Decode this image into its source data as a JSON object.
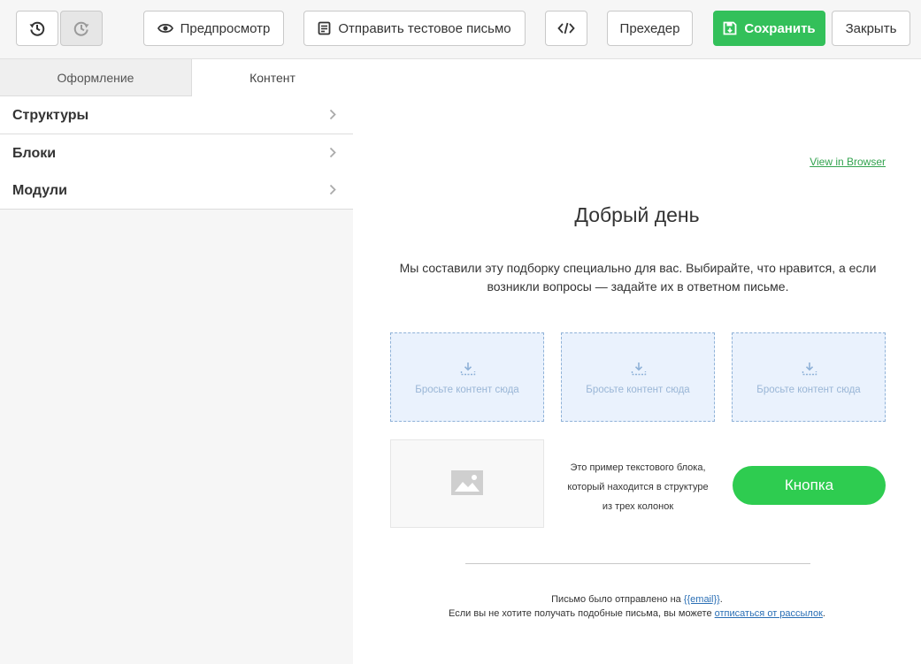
{
  "toolbar": {
    "history_back_icon": "history-icon",
    "history_forward_icon": "history-forward-icon",
    "preview_label": "Предпросмотр",
    "preview_icon": "eye-icon",
    "test_email_label": "Отправить тестовое письмо",
    "test_email_icon": "document-icon",
    "code_icon": "code-icon",
    "preheader_label": "Прехедер",
    "save_label": "Сохранить",
    "save_icon": "save-icon",
    "close_label": "Закрыть"
  },
  "panel": {
    "tabs": [
      {
        "label": "Оформление",
        "active": false
      },
      {
        "label": "Контент",
        "active": true
      }
    ],
    "sections": [
      {
        "label": "Структуры"
      },
      {
        "label": "Блоки"
      },
      {
        "label": "Модули"
      }
    ]
  },
  "email": {
    "view_in_browser": "View in Browser",
    "greeting": "Добрый день",
    "intro_line1": "Мы составили эту подборку специально для вас. Выбирайте, что нравится, а если",
    "intro_line2": "возникли вопросы — задайте их в ответном письме.",
    "drop_zones": [
      {
        "label": "Бросьте контент сюда"
      },
      {
        "label": "Бросьте контент сюда"
      },
      {
        "label": "Бросьте контент сюда"
      }
    ],
    "image_placeholder_icon": "image-icon",
    "sample_text_line1": "Это пример текстового блока,",
    "sample_text_line2": "который находится в структуре",
    "sample_text_line3": "из трех колонок",
    "button_label": "Кнопка",
    "footer": {
      "sent_prefix": "Письмо было отправлено на ",
      "email_var": "{{email}}",
      "sent_suffix": ".",
      "unsub_prefix": "Если вы не хотите получать подобные письма, вы можете ",
      "unsub_link": "отписаться от рассылок",
      "unsub_suffix": "."
    }
  },
  "colors": {
    "accent_green": "#33c05a",
    "button_green": "#2ecc50",
    "link_green": "#33a34f",
    "drop_bg": "#eaf2fd",
    "drop_border": "#8fb2d8",
    "link_blue": "#2a6fb5"
  }
}
